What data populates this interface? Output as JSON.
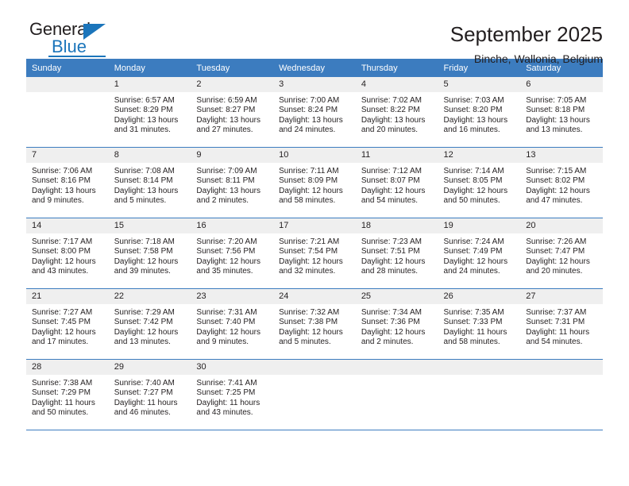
{
  "logo": {
    "word_general": "General",
    "word_blue": "Blue",
    "accent_color": "#1b75bb"
  },
  "header": {
    "title": "September 2025",
    "location": "Binche, Wallonia, Belgium"
  },
  "calendar": {
    "header_color": "#3c7cbf",
    "daynum_band_color": "#efefef",
    "weekday_names": [
      "Sunday",
      "Monday",
      "Tuesday",
      "Wednesday",
      "Thursday",
      "Friday",
      "Saturday"
    ],
    "weeks": [
      [
        {
          "day": "",
          "empty": true,
          "lines": []
        },
        {
          "day": "1",
          "lines": [
            "Sunrise: 6:57 AM",
            "Sunset: 8:29 PM",
            "Daylight: 13 hours",
            "and 31 minutes."
          ]
        },
        {
          "day": "2",
          "lines": [
            "Sunrise: 6:59 AM",
            "Sunset: 8:27 PM",
            "Daylight: 13 hours",
            "and 27 minutes."
          ]
        },
        {
          "day": "3",
          "lines": [
            "Sunrise: 7:00 AM",
            "Sunset: 8:24 PM",
            "Daylight: 13 hours",
            "and 24 minutes."
          ]
        },
        {
          "day": "4",
          "lines": [
            "Sunrise: 7:02 AM",
            "Sunset: 8:22 PM",
            "Daylight: 13 hours",
            "and 20 minutes."
          ]
        },
        {
          "day": "5",
          "lines": [
            "Sunrise: 7:03 AM",
            "Sunset: 8:20 PM",
            "Daylight: 13 hours",
            "and 16 minutes."
          ]
        },
        {
          "day": "6",
          "lines": [
            "Sunrise: 7:05 AM",
            "Sunset: 8:18 PM",
            "Daylight: 13 hours",
            "and 13 minutes."
          ]
        }
      ],
      [
        {
          "day": "7",
          "lines": [
            "Sunrise: 7:06 AM",
            "Sunset: 8:16 PM",
            "Daylight: 13 hours",
            "and 9 minutes."
          ]
        },
        {
          "day": "8",
          "lines": [
            "Sunrise: 7:08 AM",
            "Sunset: 8:14 PM",
            "Daylight: 13 hours",
            "and 5 minutes."
          ]
        },
        {
          "day": "9",
          "lines": [
            "Sunrise: 7:09 AM",
            "Sunset: 8:11 PM",
            "Daylight: 13 hours",
            "and 2 minutes."
          ]
        },
        {
          "day": "10",
          "lines": [
            "Sunrise: 7:11 AM",
            "Sunset: 8:09 PM",
            "Daylight: 12 hours",
            "and 58 minutes."
          ]
        },
        {
          "day": "11",
          "lines": [
            "Sunrise: 7:12 AM",
            "Sunset: 8:07 PM",
            "Daylight: 12 hours",
            "and 54 minutes."
          ]
        },
        {
          "day": "12",
          "lines": [
            "Sunrise: 7:14 AM",
            "Sunset: 8:05 PM",
            "Daylight: 12 hours",
            "and 50 minutes."
          ]
        },
        {
          "day": "13",
          "lines": [
            "Sunrise: 7:15 AM",
            "Sunset: 8:02 PM",
            "Daylight: 12 hours",
            "and 47 minutes."
          ]
        }
      ],
      [
        {
          "day": "14",
          "lines": [
            "Sunrise: 7:17 AM",
            "Sunset: 8:00 PM",
            "Daylight: 12 hours",
            "and 43 minutes."
          ]
        },
        {
          "day": "15",
          "lines": [
            "Sunrise: 7:18 AM",
            "Sunset: 7:58 PM",
            "Daylight: 12 hours",
            "and 39 minutes."
          ]
        },
        {
          "day": "16",
          "lines": [
            "Sunrise: 7:20 AM",
            "Sunset: 7:56 PM",
            "Daylight: 12 hours",
            "and 35 minutes."
          ]
        },
        {
          "day": "17",
          "lines": [
            "Sunrise: 7:21 AM",
            "Sunset: 7:54 PM",
            "Daylight: 12 hours",
            "and 32 minutes."
          ]
        },
        {
          "day": "18",
          "lines": [
            "Sunrise: 7:23 AM",
            "Sunset: 7:51 PM",
            "Daylight: 12 hours",
            "and 28 minutes."
          ]
        },
        {
          "day": "19",
          "lines": [
            "Sunrise: 7:24 AM",
            "Sunset: 7:49 PM",
            "Daylight: 12 hours",
            "and 24 minutes."
          ]
        },
        {
          "day": "20",
          "lines": [
            "Sunrise: 7:26 AM",
            "Sunset: 7:47 PM",
            "Daylight: 12 hours",
            "and 20 minutes."
          ]
        }
      ],
      [
        {
          "day": "21",
          "lines": [
            "Sunrise: 7:27 AM",
            "Sunset: 7:45 PM",
            "Daylight: 12 hours",
            "and 17 minutes."
          ]
        },
        {
          "day": "22",
          "lines": [
            "Sunrise: 7:29 AM",
            "Sunset: 7:42 PM",
            "Daylight: 12 hours",
            "and 13 minutes."
          ]
        },
        {
          "day": "23",
          "lines": [
            "Sunrise: 7:31 AM",
            "Sunset: 7:40 PM",
            "Daylight: 12 hours",
            "and 9 minutes."
          ]
        },
        {
          "day": "24",
          "lines": [
            "Sunrise: 7:32 AM",
            "Sunset: 7:38 PM",
            "Daylight: 12 hours",
            "and 5 minutes."
          ]
        },
        {
          "day": "25",
          "lines": [
            "Sunrise: 7:34 AM",
            "Sunset: 7:36 PM",
            "Daylight: 12 hours",
            "and 2 minutes."
          ]
        },
        {
          "day": "26",
          "lines": [
            "Sunrise: 7:35 AM",
            "Sunset: 7:33 PM",
            "Daylight: 11 hours",
            "and 58 minutes."
          ]
        },
        {
          "day": "27",
          "lines": [
            "Sunrise: 7:37 AM",
            "Sunset: 7:31 PM",
            "Daylight: 11 hours",
            "and 54 minutes."
          ]
        }
      ],
      [
        {
          "day": "28",
          "lines": [
            "Sunrise: 7:38 AM",
            "Sunset: 7:29 PM",
            "Daylight: 11 hours",
            "and 50 minutes."
          ]
        },
        {
          "day": "29",
          "lines": [
            "Sunrise: 7:40 AM",
            "Sunset: 7:27 PM",
            "Daylight: 11 hours",
            "and 46 minutes."
          ]
        },
        {
          "day": "30",
          "lines": [
            "Sunrise: 7:41 AM",
            "Sunset: 7:25 PM",
            "Daylight: 11 hours",
            "and 43 minutes."
          ]
        },
        {
          "day": "",
          "empty": true,
          "lines": []
        },
        {
          "day": "",
          "empty": true,
          "lines": []
        },
        {
          "day": "",
          "empty": true,
          "lines": []
        },
        {
          "day": "",
          "empty": true,
          "lines": []
        }
      ]
    ]
  }
}
